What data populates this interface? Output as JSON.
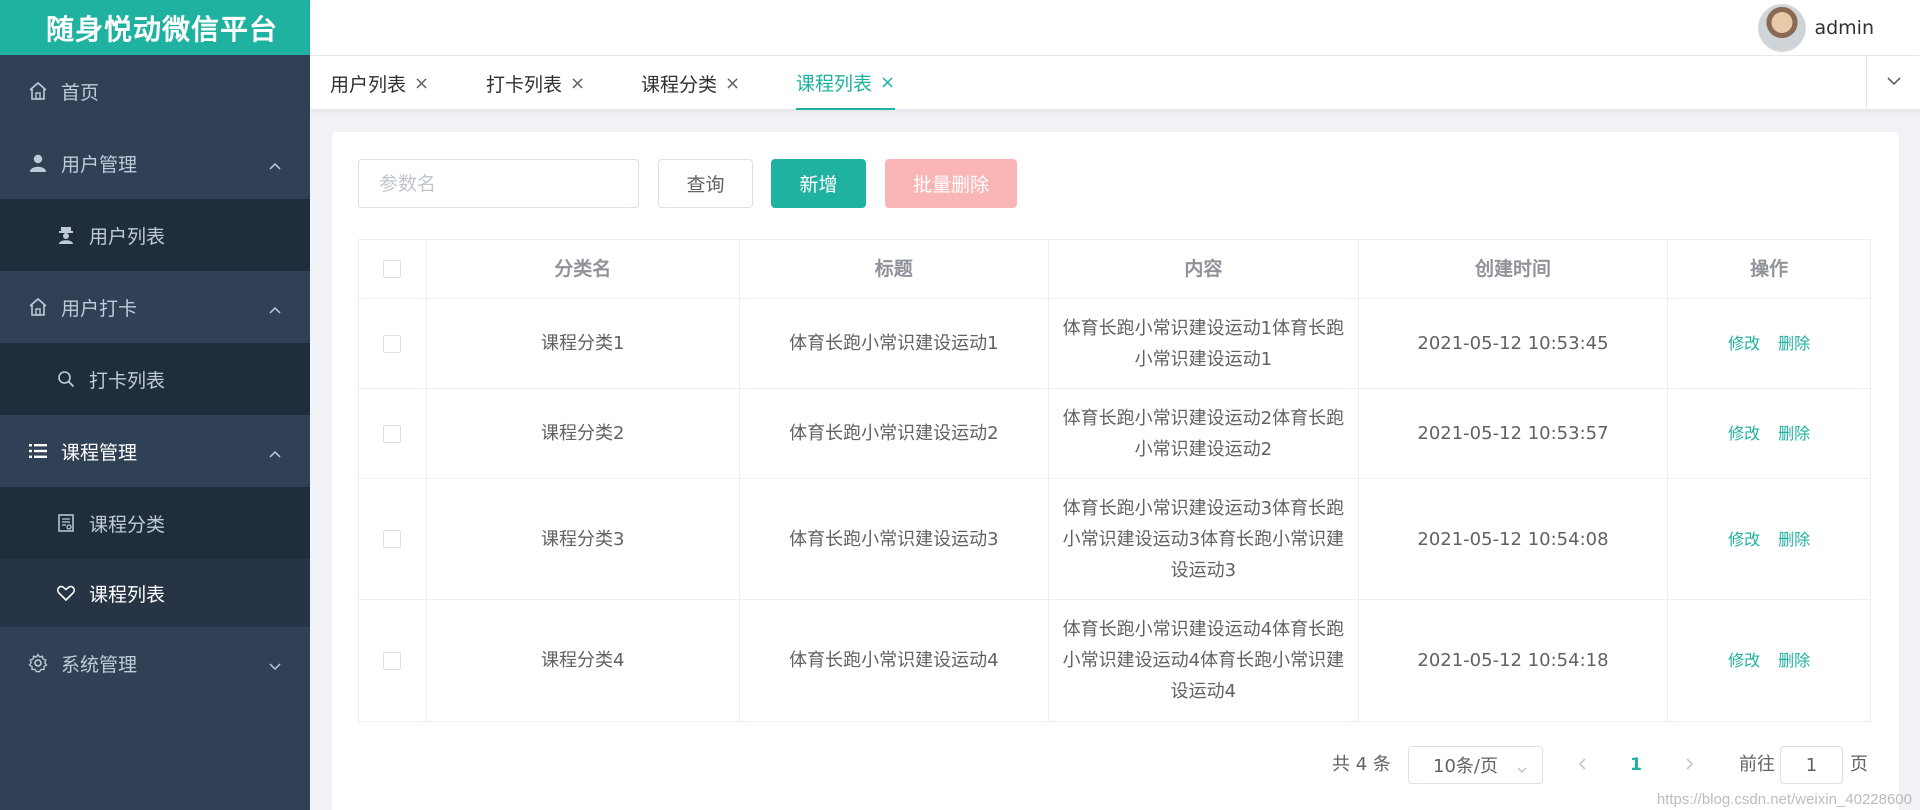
{
  "app": {
    "title": "随身悦动微信平台",
    "user": "admin",
    "accent_color": "#20b2a0"
  },
  "sidebar": {
    "items": [
      {
        "label": "首页",
        "icon": "home-icon"
      },
      {
        "label": "用户管理",
        "icon": "user-icon",
        "expanded": true
      },
      {
        "label": "用户列表",
        "icon": "user-secret-icon"
      },
      {
        "label": "用户打卡",
        "icon": "home-icon",
        "expanded": true
      },
      {
        "label": "打卡列表",
        "icon": "search-icon"
      },
      {
        "label": "课程管理",
        "icon": "list-icon",
        "expanded": true
      },
      {
        "label": "课程分类",
        "icon": "document-icon"
      },
      {
        "label": "课程列表",
        "icon": "heart-icon",
        "active": true
      },
      {
        "label": "系统管理",
        "icon": "gear-icon",
        "expanded": false
      }
    ]
  },
  "tabs": [
    {
      "label": "用户列表",
      "close": "×"
    },
    {
      "label": "打卡列表",
      "close": "×"
    },
    {
      "label": "课程分类",
      "close": "×"
    },
    {
      "label": "课程列表",
      "close": "×",
      "active": true
    }
  ],
  "toolbar": {
    "search_placeholder": "参数名",
    "query_label": "查询",
    "add_label": "新增",
    "batch_delete_label": "批量删除"
  },
  "table": {
    "headers": [
      "分类名",
      "标题",
      "内容",
      "创建时间",
      "操作"
    ],
    "rows": [
      {
        "category": "课程分类1",
        "title": "体育长跑小常识建设运动1",
        "content": "体育长跑小常识建设运动1体育长跑小常识建设运动1",
        "created": "2021-05-12 10:53:45"
      },
      {
        "category": "课程分类2",
        "title": "体育长跑小常识建设运动2",
        "content": "体育长跑小常识建设运动2体育长跑小常识建设运动2",
        "created": "2021-05-12 10:53:57"
      },
      {
        "category": "课程分类3",
        "title": "体育长跑小常识建设运动3",
        "content": "体育长跑小常识建设运动3体育长跑小常识建设运动3体育长跑小常识建设运动3",
        "created": "2021-05-12 10:54:08"
      },
      {
        "category": "课程分类4",
        "title": "体育长跑小常识建设运动4",
        "content": "体育长跑小常识建设运动4体育长跑小常识建设运动4体育长跑小常识建设运动4",
        "created": "2021-05-12 10:54:18"
      }
    ],
    "edit_label": "修改",
    "delete_label": "删除"
  },
  "pagination": {
    "total_text": "共 4 条",
    "page_size": "10条/页",
    "current_page": "1",
    "goto_label": "前往",
    "goto_value": "1",
    "goto_suffix": "页"
  },
  "watermark": "https://blog.csdn.net/weixin_40228600"
}
